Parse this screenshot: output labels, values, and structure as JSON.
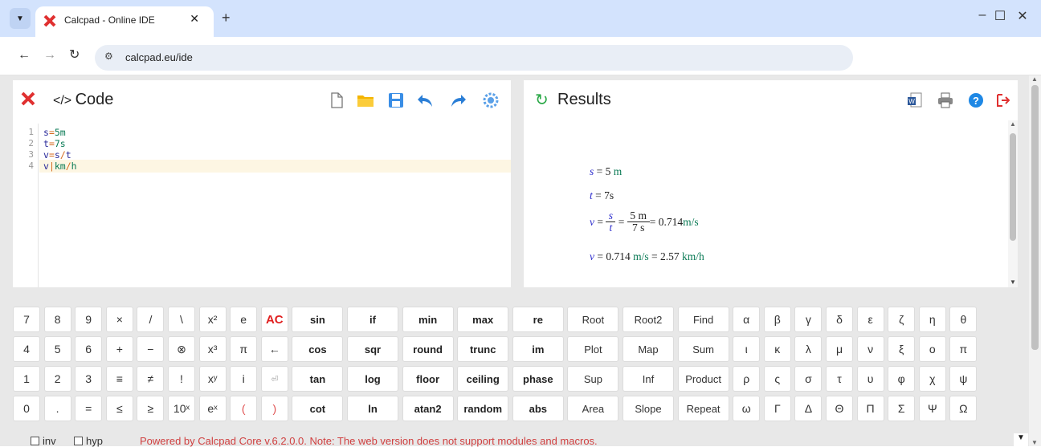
{
  "browser": {
    "tab_title": "Calcpad - Online IDE",
    "tab_close": "✕",
    "new_tab": "+",
    "url": "calcpad.eu/ide",
    "minimize": "–",
    "maximize": "☐",
    "close": "✕"
  },
  "code_panel": {
    "title": "Code",
    "lines": [
      {
        "num": "1",
        "parts": [
          {
            "t": "s",
            "c": "v"
          },
          {
            "t": "=",
            "c": "op"
          },
          {
            "t": "5m",
            "c": "u"
          }
        ]
      },
      {
        "num": "2",
        "parts": [
          {
            "t": "t",
            "c": "v"
          },
          {
            "t": "=",
            "c": "op"
          },
          {
            "t": "7s",
            "c": "u"
          }
        ]
      },
      {
        "num": "3",
        "parts": [
          {
            "t": "v",
            "c": "v"
          },
          {
            "t": "=",
            "c": "op"
          },
          {
            "t": "s",
            "c": "v"
          },
          {
            "t": "/",
            "c": "op"
          },
          {
            "t": "t",
            "c": "v"
          }
        ]
      },
      {
        "num": "4",
        "parts": [
          {
            "t": "v",
            "c": "v"
          },
          {
            "t": "|",
            "c": "op"
          },
          {
            "t": "km",
            "c": "u"
          },
          {
            "t": "/",
            "c": "op"
          },
          {
            "t": "h",
            "c": "u"
          }
        ]
      }
    ]
  },
  "results_panel": {
    "title": "Results",
    "lines": [
      {
        "var": "s",
        "eq": " = 5",
        "unit": "m"
      },
      {
        "var": "t",
        "eq": " = 7s",
        "unit": ""
      },
      {
        "var": "v",
        "frac1_num": "s",
        "frac1_den": "t",
        "frac2_num": "5 m",
        "frac2_den": "7 s",
        "result": " = 0.714 ",
        "unit": "m/s"
      },
      {
        "var": "v",
        "eq": " = 0.714 ",
        "unit1": "m/s",
        "eq2": " = 2.57 ",
        "unit2": "km/h"
      }
    ]
  },
  "keypad": {
    "rows": [
      [
        "7",
        "8",
        "9",
        "×",
        "/",
        "\\",
        "x²",
        "e",
        "AC",
        "sin",
        "if",
        "min",
        "max",
        "re",
        "Root",
        "Root2",
        "Find",
        "α",
        "β",
        "γ",
        "δ",
        "ε",
        "ζ",
        "η",
        "θ"
      ],
      [
        "4",
        "5",
        "6",
        "+",
        "−",
        "⊗",
        "x³",
        "π",
        "←",
        "cos",
        "sqr",
        "round",
        "trunc",
        "im",
        "Plot",
        "Map",
        "Sum",
        "ι",
        "κ",
        "λ",
        "μ",
        "ν",
        "ξ",
        "ο",
        "π"
      ],
      [
        "1",
        "2",
        "3",
        "≡",
        "≠",
        "!",
        "xʸ",
        "i",
        "⏎",
        "tan",
        "log",
        "floor",
        "ceiling",
        "phase",
        "Sup",
        "Inf",
        "Product",
        "ρ",
        "ς",
        "σ",
        "τ",
        "υ",
        "φ",
        "χ",
        "ψ"
      ],
      [
        "0",
        ".",
        "=",
        "≤",
        "≥",
        "10ˣ",
        "eˣ",
        "(",
        ")",
        "cot",
        "ln",
        "atan2",
        "random",
        "abs",
        "Area",
        "Slope",
        "Repeat",
        "ω",
        "Γ",
        "Δ",
        "Θ",
        "Π",
        "Σ",
        "Ψ",
        "Ω"
      ]
    ]
  },
  "footer": {
    "inv_label": "inv",
    "hyp_label": "hyp",
    "powered_text": "Powered by Calcpad Core v.6.2.0.0. Note: The web version does not support modules and macros."
  }
}
